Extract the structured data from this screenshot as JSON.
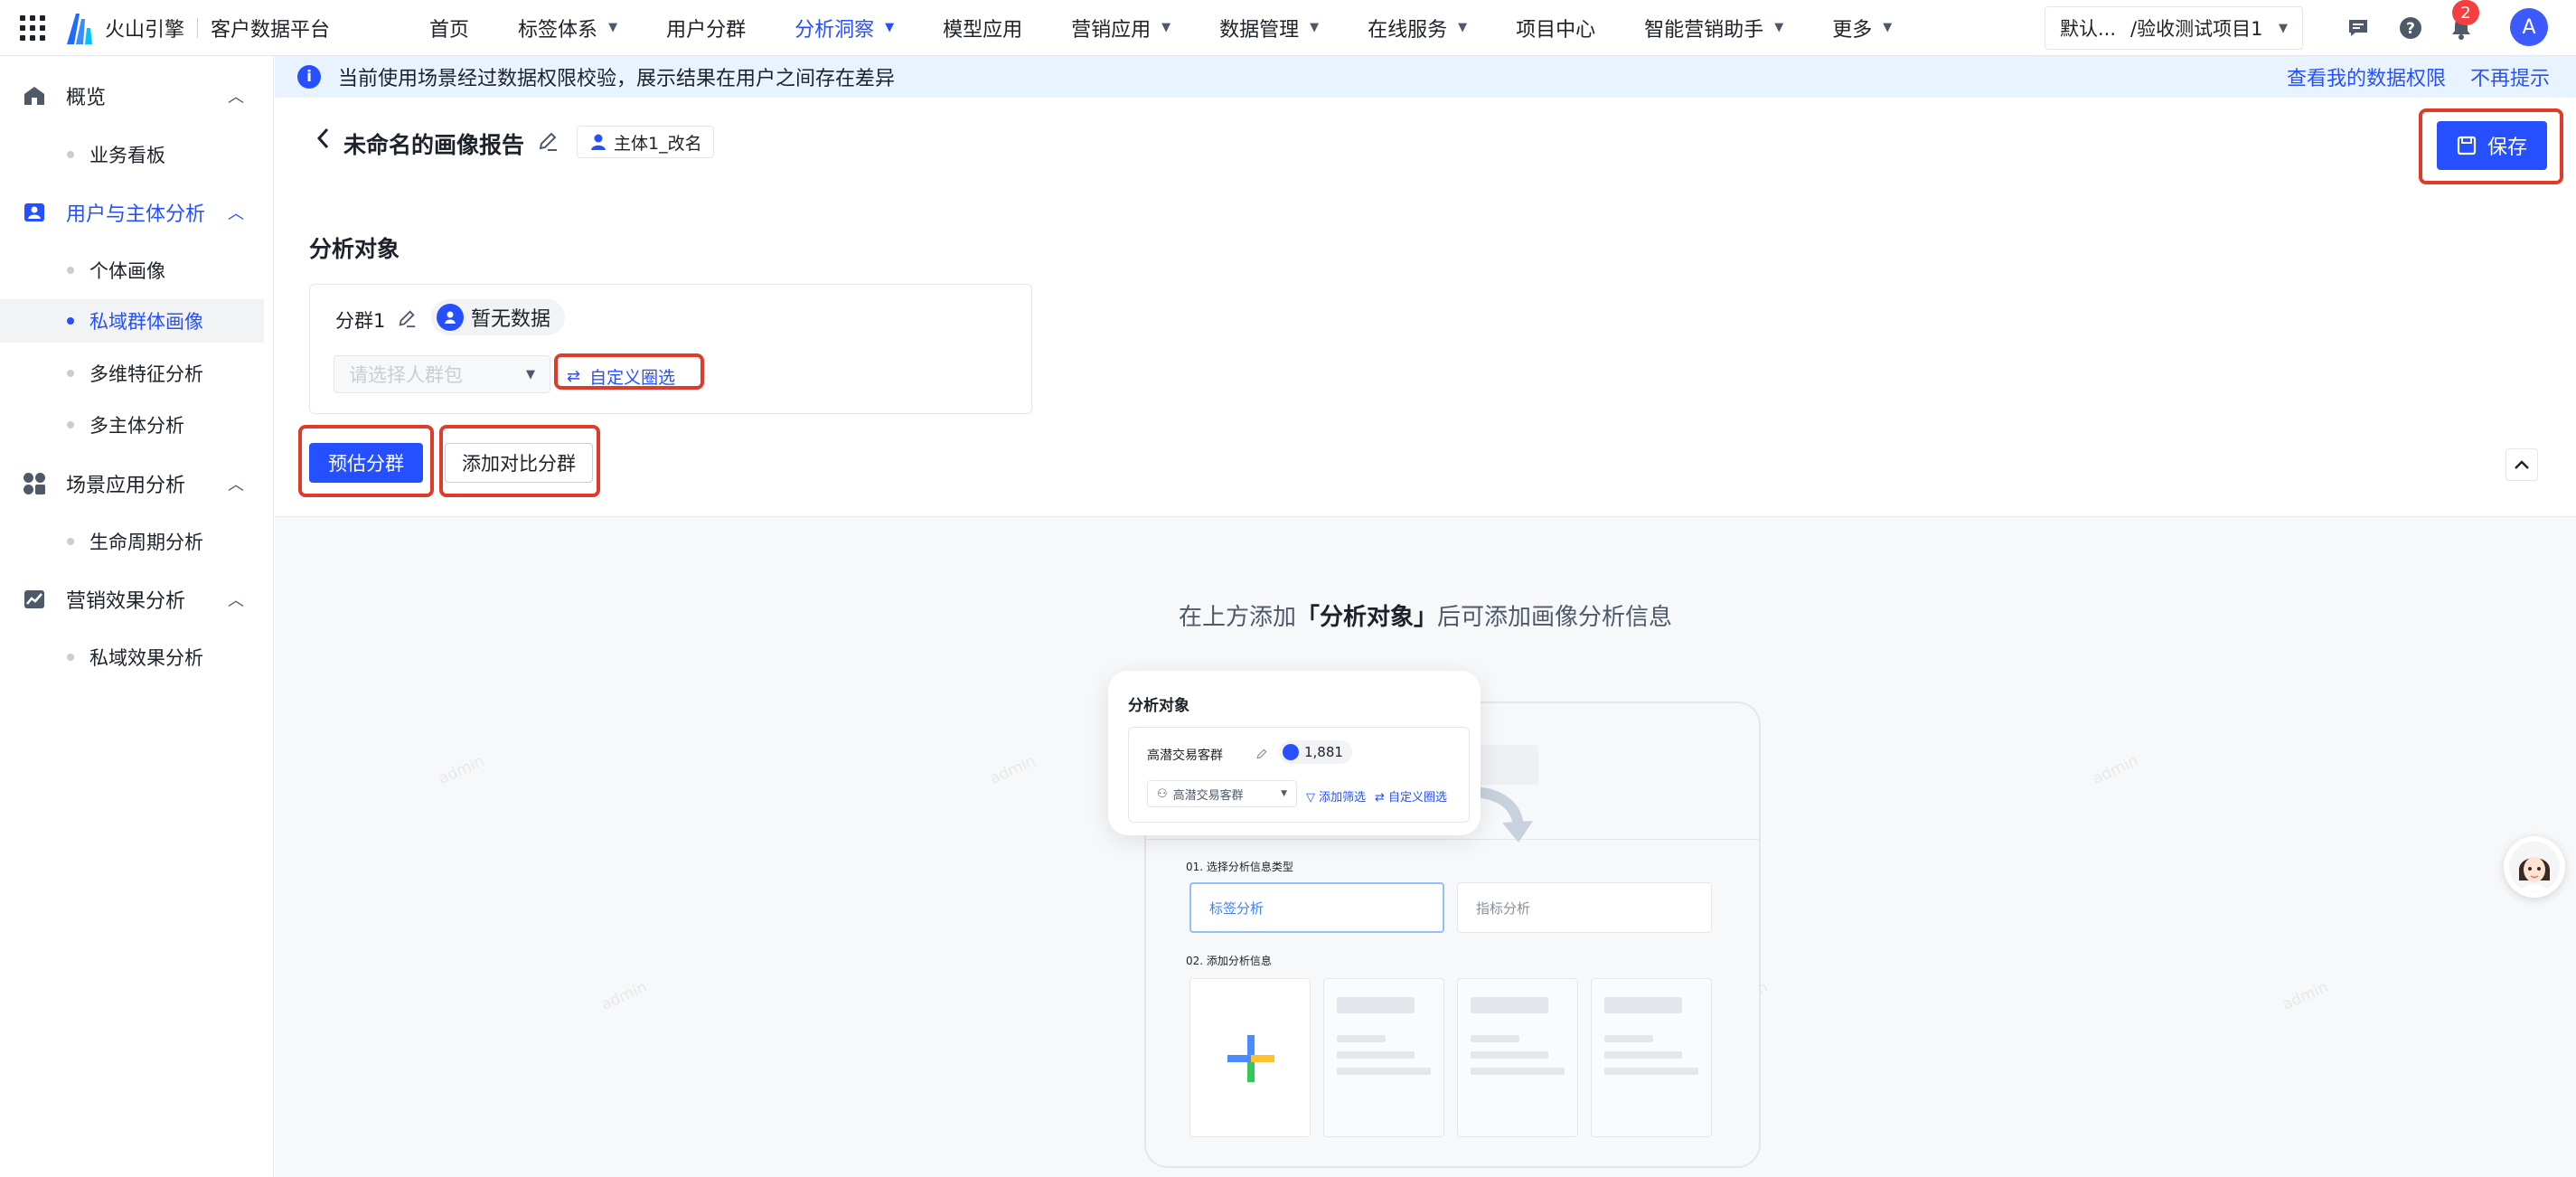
{
  "brand": {
    "name": "火山引擎",
    "sub": "客户数据平台"
  },
  "nav": [
    {
      "label": "首页",
      "dropdown": false,
      "active": false
    },
    {
      "label": "标签体系",
      "dropdown": true,
      "active": false
    },
    {
      "label": "用户分群",
      "dropdown": false,
      "active": false
    },
    {
      "label": "分析洞察",
      "dropdown": true,
      "active": true
    },
    {
      "label": "模型应用",
      "dropdown": false,
      "active": false
    },
    {
      "label": "营销应用",
      "dropdown": true,
      "active": false
    },
    {
      "label": "数据管理",
      "dropdown": true,
      "active": false
    },
    {
      "label": "在线服务",
      "dropdown": true,
      "active": false
    },
    {
      "label": "项目中心",
      "dropdown": false,
      "active": false
    },
    {
      "label": "智能营销助手",
      "dropdown": true,
      "active": false
    },
    {
      "label": "更多",
      "dropdown": true,
      "active": false
    }
  ],
  "project": {
    "label": "默认...",
    "project": "/验收测试项目1"
  },
  "topbar": {
    "notification_count": "2",
    "avatar_initial": "A"
  },
  "sidebar": {
    "groups": [
      {
        "label": "概览",
        "icon": "home-icon",
        "active": false,
        "items": [
          {
            "label": "业务看板",
            "active": false
          }
        ]
      },
      {
        "label": "用户与主体分析",
        "icon": "user-card-icon",
        "active": true,
        "items": [
          {
            "label": "个体画像",
            "active": false
          },
          {
            "label": "私域群体画像",
            "active": true
          },
          {
            "label": "多维特征分析",
            "active": false
          },
          {
            "label": "多主体分析",
            "active": false
          }
        ]
      },
      {
        "label": "场景应用分析",
        "icon": "apps-icon",
        "active": false,
        "items": [
          {
            "label": "生命周期分析",
            "active": false
          }
        ]
      },
      {
        "label": "营销效果分析",
        "icon": "trend-icon",
        "active": false,
        "items": [
          {
            "label": "私域效果分析",
            "active": false
          }
        ]
      }
    ]
  },
  "notice": {
    "text": "当前使用场景经过数据权限校验，展示结果在用户之间存在差异",
    "link_view": "查看我的数据权限",
    "link_dismiss": "不再提示"
  },
  "header": {
    "title": "未命名的画像报告",
    "subject": "主体1_改名",
    "save_label": "保存"
  },
  "analysis": {
    "section_title": "分析对象",
    "group_name": "分群1",
    "group_status": "暂无数据",
    "crowd_placeholder": "请选择人群包",
    "custom_select": "自定义圈选",
    "estimate_button": "预估分群",
    "add_compare_button": "添加对比分群"
  },
  "empty": {
    "hint_before": "在上方添加",
    "hint_bold": "「分析对象」",
    "hint_after": "后可添加画像分析信息"
  },
  "illustration": {
    "title": "分析对象",
    "group_name": "高潜交易客群",
    "count": "1,881",
    "select_value": "高潜交易客群",
    "add_filter": "添加筛选",
    "custom_select": "自定义圈选",
    "step1": "01. 选择分析信息类型",
    "option_tag": "标签分析",
    "option_metric": "指标分析",
    "step2": "02. 添加分析信息"
  },
  "watermark": "admin",
  "colors": {
    "primary": "#2650ff",
    "highlight": "#e03b2a",
    "notice_bg": "#e8f3ff"
  }
}
